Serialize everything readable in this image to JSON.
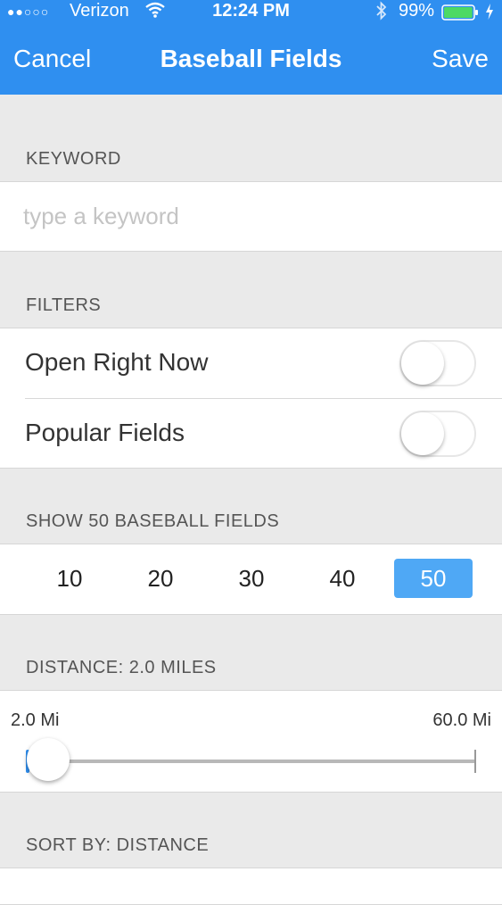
{
  "status_bar": {
    "signal": "●●○○○",
    "carrier": "Verizon",
    "wifi_icon": "wifi-icon",
    "time": "12:24 PM",
    "bluetooth_icon": "bluetooth-icon",
    "battery_percent": "99%",
    "battery_level": 0.99,
    "charging_icon": "bolt-icon"
  },
  "navbar": {
    "cancel_label": "Cancel",
    "title": "Baseball Fields",
    "save_label": "Save"
  },
  "keyword": {
    "header": "KEYWORD",
    "value": "",
    "placeholder": "type a keyword"
  },
  "filters": {
    "header": "FILTERS",
    "items": [
      {
        "label": "Open Right Now",
        "on": false
      },
      {
        "label": "Popular Fields",
        "on": false
      }
    ]
  },
  "show": {
    "header": "SHOW 50 BASEBALL FIELDS",
    "options": [
      "10",
      "20",
      "30",
      "40",
      "50"
    ],
    "selected": "50"
  },
  "distance": {
    "header": "DISTANCE:  2.0 MILES",
    "min_label": "2.0 Mi",
    "max_label": "60.0 Mi",
    "value": 2.0,
    "min": 2.0,
    "max": 60.0
  },
  "sort": {
    "header": "SORT BY: DISTANCE"
  },
  "colors": {
    "accent": "#2f8ff0",
    "selected_segment": "#4fa8f5",
    "background": "#eaeaea"
  }
}
